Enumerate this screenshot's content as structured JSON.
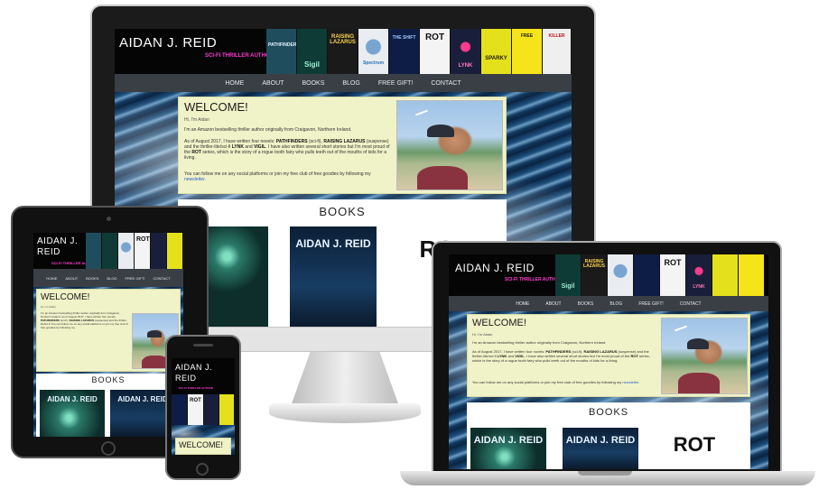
{
  "site": {
    "author": "AIDAN J. REID",
    "author_phone": "AIDAN J.",
    "author_phone_2": "REID",
    "tagline": "SCI-FI THRILLER AUTHOR",
    "nav": [
      "HOME",
      "ABOUT",
      "BOOKS",
      "BLOG",
      "FREE GIFT!",
      "CONTACT"
    ],
    "welcome_title": "WELCOME!",
    "byline": "Hi, I'm Aidan",
    "intro": "I'm an Amazon bestselling thriller author originally from Craigavon, Northern Ireland.",
    "para2_a": "As of August 2017, I have written four novels:",
    "para2_b": "PATHFINDERS",
    "para2_c": "(sci-fi),",
    "para2_d": "RAISING LAZARUS",
    "para2_e": "(suspense) and the thriller-lite/sci-fi",
    "para2_f": "LYNK",
    "para2_g": "and",
    "para2_h": "VIGIL",
    "para2_i": ". I have also written several short stories but I'm most proud of the",
    "para2_j": "ROT",
    "para2_k": "series, which is the story of a rogue tooth fairy who pulls teeth out of the mouths of kids for a living.",
    "para3": "You can follow me on any social platforms or join my free club of free goodies by following my",
    "newsletter_link": "newsletter.",
    "books_heading": "BOOKS",
    "books": [
      {
        "title": "AIDAN J. REID",
        "theme": "forest"
      },
      {
        "title": "AIDAN J. REID",
        "theme": "night"
      },
      {
        "title": "ROT",
        "theme": "rot"
      }
    ],
    "covers": [
      {
        "label": "PATHFINDERS",
        "bg": "#1f4d5e",
        "fg": "#e6f3ff"
      },
      {
        "label": "Sigil",
        "bg": "#0e3b35",
        "fg": "#9ff0d0"
      },
      {
        "label": "RAISING LAZARUS",
        "bg": "#1a1a1a",
        "fg": "#ffd24a"
      },
      {
        "label": "Spectrum",
        "bg": "#e9edf2",
        "fg": "#2b6fb8"
      },
      {
        "label": "THE SHIFT",
        "bg": "#0d1d46",
        "fg": "#9fc6ff"
      },
      {
        "label": "ROT",
        "bg": "#f4f4f4",
        "fg": "#111111"
      },
      {
        "label": "LYNK",
        "bg": "#191f3a",
        "fg": "#ff77b8"
      },
      {
        "label": "SPARKY",
        "bg": "#e4e11c",
        "fg": "#1a1a1a"
      },
      {
        "label": "FREE",
        "bg": "#f6e41a",
        "fg": "#1d1d1d"
      },
      {
        "label": "KILLER",
        "bg": "#efefef",
        "fg": "#c81212"
      }
    ]
  },
  "devices": [
    "desktop-monitor",
    "tablet",
    "phone",
    "laptop"
  ]
}
